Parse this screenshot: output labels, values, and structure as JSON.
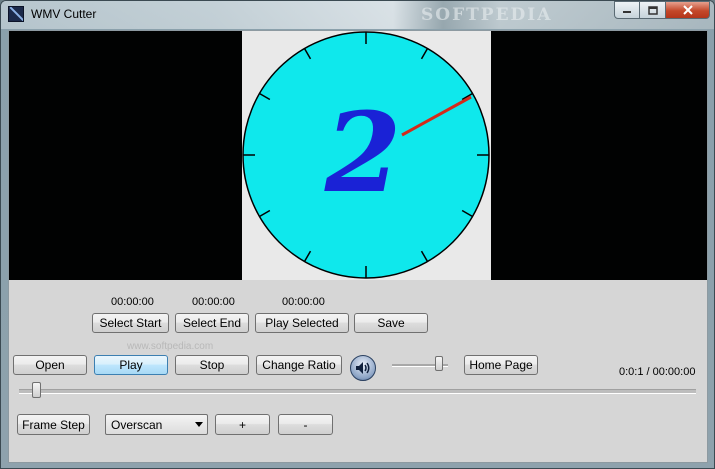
{
  "window": {
    "title": "WMV Cutter",
    "watermark": "SOFTPEDIA"
  },
  "colors": {
    "clock_face": "#0fe8ec",
    "digit": "#1a22d6",
    "hand": "#d42a1a",
    "video_bg": "#010202",
    "client_bg": "#d6d6d6"
  },
  "video": {
    "clock_digit": "2"
  },
  "watermark_url": "www.softpedia.com",
  "selection": {
    "start_time": "00:00:00",
    "end_time": "00:00:00",
    "selected_time": "00:00:00",
    "select_start_label": "Select Start",
    "select_end_label": "Select End",
    "play_selected_label": "Play Selected",
    "save_label": "Save"
  },
  "controls": {
    "open_label": "Open",
    "play_label": "Play",
    "stop_label": "Stop",
    "change_ratio_label": "Change Ratio",
    "home_page_label": "Home Page",
    "position_readout": "0:0:1 / 00:00:00",
    "volume_level_pct": 90,
    "seek_position_pct": 2
  },
  "bottom": {
    "frame_step_label": "Frame Step",
    "aspect_mode_value": "Overscan",
    "plus_label": "+",
    "minus_label": "-"
  },
  "icons": {
    "volume": "speaker-icon",
    "dropdown": "chevron-down-icon"
  }
}
